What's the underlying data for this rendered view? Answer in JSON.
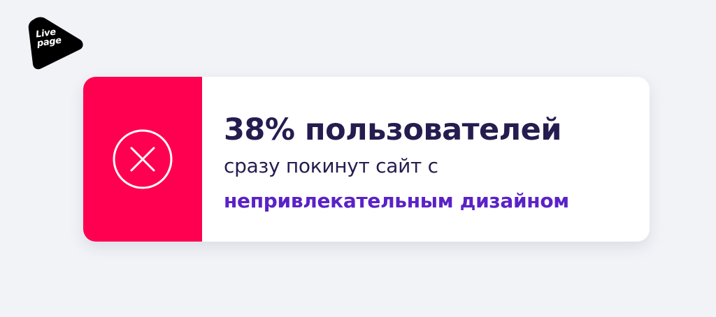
{
  "logo": {
    "line1": "Live",
    "line2": "page"
  },
  "card": {
    "headline": "38% пользователей",
    "subline": "сразу покинут сайт с",
    "emphasis": "непривлекательным дизайном",
    "icon": "close-circle-icon"
  },
  "colors": {
    "background": "#f1f3f7",
    "accent": "#ff0050",
    "headline": "#251c4f",
    "emphasis": "#5a22c7",
    "logo": "#000000"
  }
}
